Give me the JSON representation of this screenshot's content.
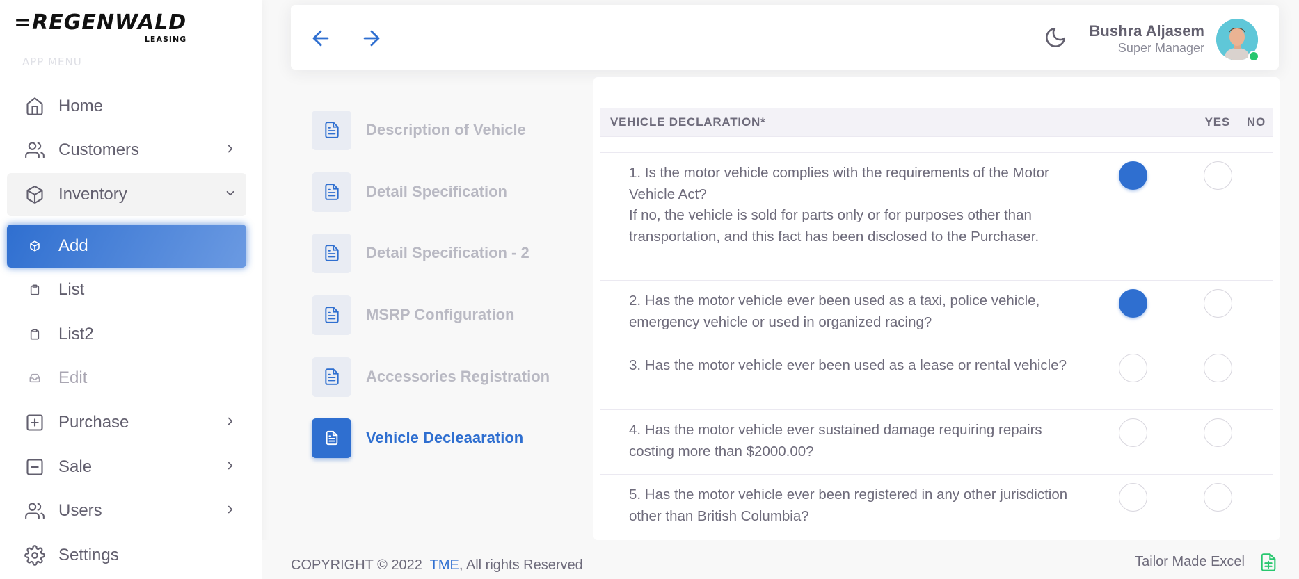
{
  "sidebar": {
    "logo_main": "=REGENWALD",
    "logo_sub": "LEASING",
    "menu_header": "APP MENU",
    "items": [
      {
        "label": "Home",
        "icon": "home-icon"
      },
      {
        "label": "Customers",
        "icon": "users-icon"
      },
      {
        "label": "Inventory",
        "icon": "box-icon"
      },
      {
        "label": "Add",
        "icon": "cube-icon"
      },
      {
        "label": "List",
        "icon": "clipboard-icon"
      },
      {
        "label": "List2",
        "icon": "clipboard-icon"
      },
      {
        "label": "Edit",
        "icon": "inbox-icon"
      },
      {
        "label": "Purchase",
        "icon": "plus-square-icon"
      },
      {
        "label": "Sale",
        "icon": "minus-square-icon"
      },
      {
        "label": "Users",
        "icon": "users-icon"
      },
      {
        "label": "Settings",
        "icon": "gear-icon"
      }
    ]
  },
  "header": {
    "user_name": "Bushra Aljasem",
    "user_role": "Super Manager"
  },
  "steps": [
    {
      "label": "Description of Vehicle"
    },
    {
      "label": "Detail Specification"
    },
    {
      "label": "Detail Specification - 2"
    },
    {
      "label": "MSRP Configuration"
    },
    {
      "label": "Accessories Registration"
    },
    {
      "label": "Vehicle Decleaaration"
    }
  ],
  "declaration": {
    "title": "VEHICLE DECLARATION*",
    "yes_label": "YES",
    "no_label": "NO",
    "questions": [
      {
        "text": "1. Is the motor vehicle complies with the requirements of the Motor Vehicle Act?",
        "text2": "If no, the vehicle is sold for parts only or for purposes other than transportation, and this fact has been disclosed to the Purchaser.",
        "answer": "yes"
      },
      {
        "text": "2. Has the motor vehicle ever been used as a taxi, police vehicle, emergency vehicle or used in organized racing?",
        "answer": "yes"
      },
      {
        "text": "3. Has the motor vehicle ever been used as a lease or rental vehicle?",
        "answer": ""
      },
      {
        "text": "4. Has the motor vehicle ever sustained damage requiring repairs costing more than $2000.00?",
        "answer": ""
      },
      {
        "text": "5. Has the motor vehicle ever been registered in any other jurisdiction other than British Columbia?",
        "answer": ""
      }
    ]
  },
  "footer": {
    "copyright_prefix": "COPYRIGHT © 2022",
    "copyright_link": "TME",
    "copyright_suffix": ", All rights Reserved",
    "made_by": "Tailor Made Excel"
  },
  "colors": {
    "primary": "#2f6fd0",
    "success": "#28c76f",
    "text": "#6e6b7b"
  }
}
